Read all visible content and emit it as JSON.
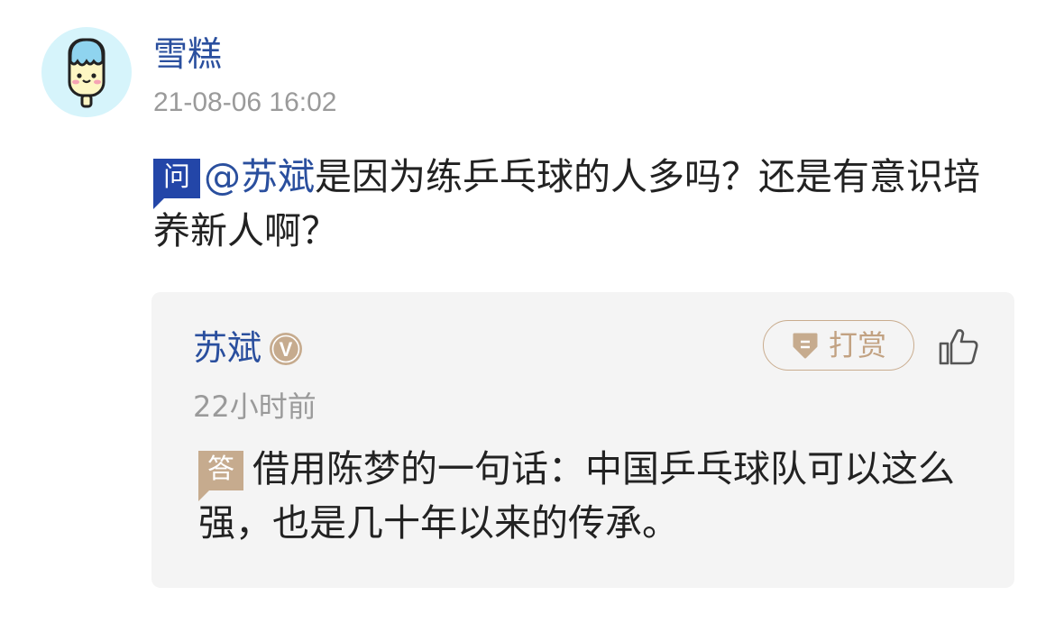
{
  "post": {
    "author": "雪糕",
    "timestamp": "21-08-06 16:02",
    "question_badge": "问",
    "mention": "@苏斌",
    "question_text": "是因为练乒乓球的人多吗？还是有意识培养新人啊？"
  },
  "answer": {
    "author": "苏斌",
    "verified_badge": "V",
    "tip_label": "打赏",
    "time": "22小时前",
    "answer_badge": "答",
    "text": "借用陈梦的一句话：中国乒乓球队可以这么强，也是几十年以来的传承。"
  },
  "icons": {
    "avatar": "ice-cream-avatar-icon",
    "verified": "verified-v-icon",
    "tip": "gem-icon",
    "like": "thumbs-up-icon"
  },
  "colors": {
    "link_blue": "#2a4f9e",
    "question_badge": "#2346a8",
    "gold": "#c6ab8e",
    "card_bg": "#f4f4f4"
  }
}
